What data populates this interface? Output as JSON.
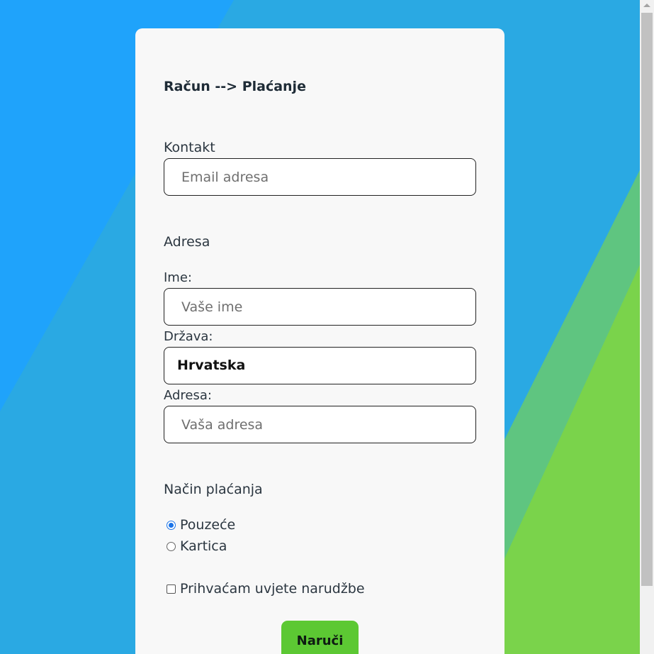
{
  "colors": {
    "bg_blue": "#1fa3fb",
    "bg_mid": "#2aa9e3",
    "bg_teal": "#5fc580",
    "bg_green": "#7ad34b",
    "card": "#f8f8f8",
    "button": "#5cc833"
  },
  "checkout": {
    "heading": "Račun --> Plaćanje",
    "contact": {
      "section_label": "Kontakt",
      "email_placeholder": "Email adresa",
      "email_value": ""
    },
    "address": {
      "section_label": "Adresa",
      "name_label": "Ime:",
      "name_placeholder": "Vaše ime",
      "country_label": "Država:",
      "country_value": "Hrvatska",
      "address_label": "Adresa:",
      "address_placeholder": "Vaša adresa"
    },
    "payment": {
      "section_label": "Način plaćanja",
      "options": [
        {
          "label": "Pouzeće",
          "selected": true
        },
        {
          "label": "Kartica",
          "selected": false
        }
      ]
    },
    "terms": {
      "label": "Prihvaćam uvjete narudžbe",
      "checked": false
    },
    "submit_label": "Naruči"
  }
}
